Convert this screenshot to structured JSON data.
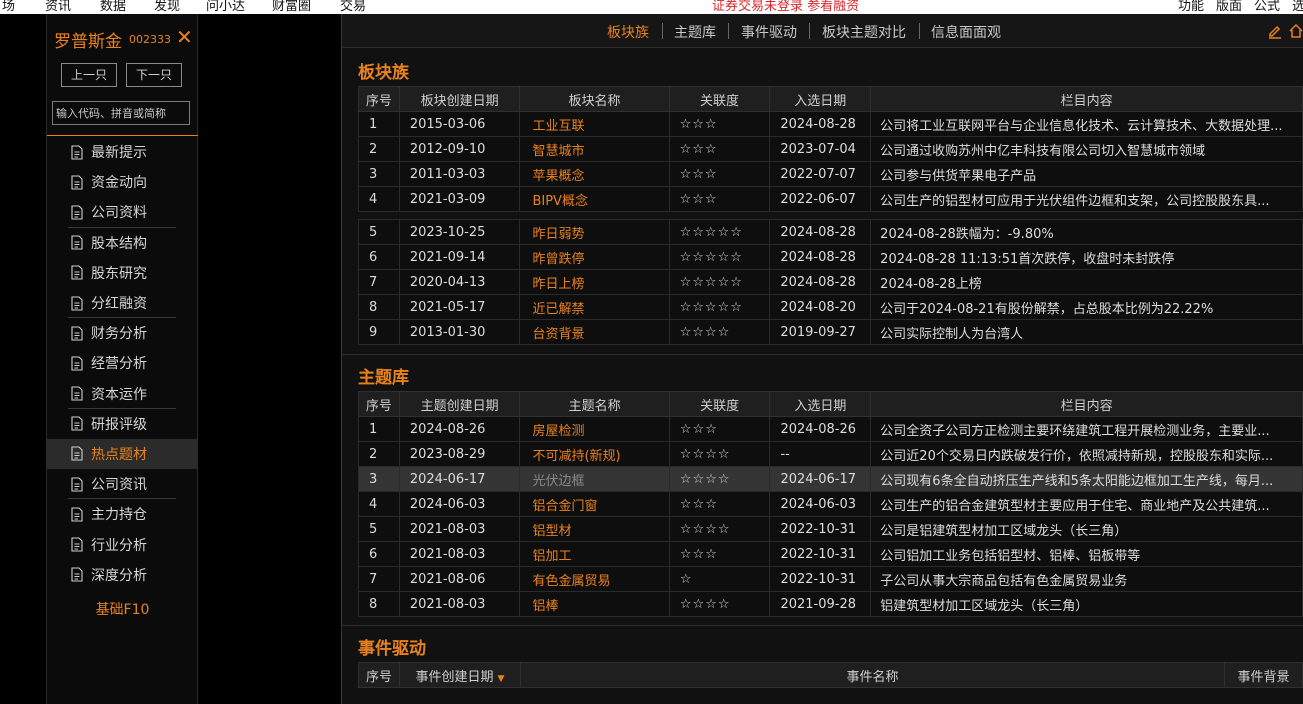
{
  "topbar": {
    "menus": [
      "场",
      "资讯",
      "数据",
      "发现",
      "问小达",
      "财富圈",
      "交易"
    ],
    "notice": "证券交易未登录  参看融资",
    "right_menus": [
      "功能",
      "版面",
      "公式",
      "选"
    ]
  },
  "sidebar": {
    "stock_name": "罗普斯金",
    "stock_code": "002333",
    "close_label": "✕",
    "prev_label": "上一只",
    "next_label": "下一只",
    "search_placeholder": "输入代码、拼音或简称",
    "items": [
      {
        "label": "最新提示",
        "divider": false
      },
      {
        "label": "资金动向",
        "divider": false
      },
      {
        "label": "公司资料",
        "divider": true
      },
      {
        "label": "股本结构",
        "divider": false
      },
      {
        "label": "股东研究",
        "divider": false
      },
      {
        "label": "分红融资",
        "divider": true
      },
      {
        "label": "财务分析",
        "divider": false
      },
      {
        "label": "经营分析",
        "divider": false
      },
      {
        "label": "资本运作",
        "divider": true
      },
      {
        "label": "研报评级",
        "divider": false
      },
      {
        "label": "热点题材",
        "divider": false,
        "active": true
      },
      {
        "label": "公司资讯",
        "divider": true
      },
      {
        "label": "主力持仓",
        "divider": false
      },
      {
        "label": "行业分析",
        "divider": false
      },
      {
        "label": "深度分析",
        "divider": false
      }
    ],
    "basic_label": "基础F10"
  },
  "tabs": {
    "items": [
      "板块族",
      "主题库",
      "事件驱动",
      "板块主题对比",
      "信息面面观"
    ],
    "active_index": 0
  },
  "block_family": {
    "title": "板块族",
    "headers": [
      "序号",
      "板块创建日期",
      "板块名称",
      "关联度",
      "入选日期",
      "栏目内容"
    ],
    "rows": [
      {
        "idx": "1",
        "date": "2015-03-06",
        "name": "工业互联",
        "stars": "☆☆☆",
        "sel_date": "2024-08-28",
        "content": "公司将工业互联网平台与企业信息化技术、云计算技术、大数据处理..."
      },
      {
        "idx": "2",
        "date": "2012-09-10",
        "name": "智慧城市",
        "stars": "☆☆☆",
        "sel_date": "2023-07-04",
        "content": "公司通过收购苏州中亿丰科技有限公司切入智慧城市领域"
      },
      {
        "idx": "3",
        "date": "2011-03-03",
        "name": "苹果概念",
        "stars": "☆☆☆",
        "sel_date": "2022-07-07",
        "content": "公司参与供货苹果电子产品"
      },
      {
        "idx": "4",
        "date": "2021-03-09",
        "name": "BIPV概念",
        "stars": "☆☆☆",
        "sel_date": "2022-06-07",
        "content": "公司生产的铝型材可应用于光伏组件边框和支架，公司控股股东具..."
      }
    ],
    "rows2": [
      {
        "idx": "5",
        "date": "2023-10-25",
        "name": "昨日弱势",
        "stars": "☆☆☆☆☆",
        "sel_date": "2024-08-28",
        "content": "2024-08-28跌幅为：-9.80%"
      },
      {
        "idx": "6",
        "date": "2021-09-14",
        "name": "昨曾跌停",
        "stars": "☆☆☆☆☆",
        "sel_date": "2024-08-28",
        "content": "2024-08-28 11:13:51首次跌停，收盘时未封跌停"
      },
      {
        "idx": "7",
        "date": "2020-04-13",
        "name": "昨日上榜",
        "stars": "☆☆☆☆☆",
        "sel_date": "2024-08-28",
        "content": "2024-08-28上榜"
      },
      {
        "idx": "8",
        "date": "2021-05-17",
        "name": "近已解禁",
        "stars": "☆☆☆☆☆",
        "sel_date": "2024-08-20",
        "content": "公司于2024-08-21有股份解禁，占总股本比例为22.22%"
      },
      {
        "idx": "9",
        "date": "2013-01-30",
        "name": "台资背景",
        "stars": "☆☆☆☆",
        "sel_date": "2019-09-27",
        "content": "公司实际控制人为台湾人"
      }
    ]
  },
  "theme_lib": {
    "title": "主题库",
    "headers": [
      "序号",
      "主题创建日期",
      "主题名称",
      "关联度",
      "入选日期",
      "栏目内容"
    ],
    "rows": [
      {
        "idx": "1",
        "date": "2024-08-26",
        "name": "房屋检测",
        "stars": "☆☆☆",
        "sel_date": "2024-08-26",
        "content": "公司全资子公司方正检测主要环绕建筑工程开展检测业务，主要业..."
      },
      {
        "idx": "2",
        "date": "2023-08-29",
        "name": "不可减持(新规)",
        "stars": "☆☆☆☆",
        "sel_date": "--",
        "content": "公司近20个交易日内跌破发行价，依照减持新规，控股股东和实际..."
      },
      {
        "idx": "3",
        "date": "2024-06-17",
        "name": "光伏边框",
        "stars": "☆☆☆☆",
        "sel_date": "2024-06-17",
        "content": "公司现有6条全自动挤压生产线和5条太阳能边框加工生产线，每月...",
        "selected": true
      },
      {
        "idx": "4",
        "date": "2024-06-03",
        "name": "铝合金门窗",
        "stars": "☆☆☆",
        "sel_date": "2024-06-03",
        "content": "公司生产的铝合金建筑型材主要应用于住宅、商业地产及公共建筑..."
      },
      {
        "idx": "5",
        "date": "2021-08-03",
        "name": "铝型材",
        "stars": "☆☆☆☆",
        "sel_date": "2022-10-31",
        "content": "公司是铝建筑型材加工区域龙头（长三角）"
      },
      {
        "idx": "6",
        "date": "2021-08-03",
        "name": "铝加工",
        "stars": "☆☆☆",
        "sel_date": "2022-10-31",
        "content": "公司铝加工业务包括铝型材、铝棒、铝板带等"
      },
      {
        "idx": "7",
        "date": "2021-08-06",
        "name": "有色金属贸易",
        "stars": "☆",
        "sel_date": "2022-10-31",
        "content": "子公司从事大宗商品包括有色金属贸易业务"
      },
      {
        "idx": "8",
        "date": "2021-08-03",
        "name": "铝棒",
        "stars": "☆☆☆☆",
        "sel_date": "2021-09-28",
        "content": "铝建筑型材加工区域龙头（长三角）"
      }
    ]
  },
  "event_driven": {
    "title": "事件驱动",
    "headers": [
      "序号",
      "事件创建日期",
      "事件名称",
      "事件背景"
    ]
  },
  "colors": {
    "accent": "#e8821e",
    "background": "#111111",
    "sidebar_bg": "#0b0b0b",
    "notice_red": "#d9262a"
  },
  "icons": [
    "document-icon",
    "close-icon",
    "edit-icon",
    "home-icon"
  ]
}
